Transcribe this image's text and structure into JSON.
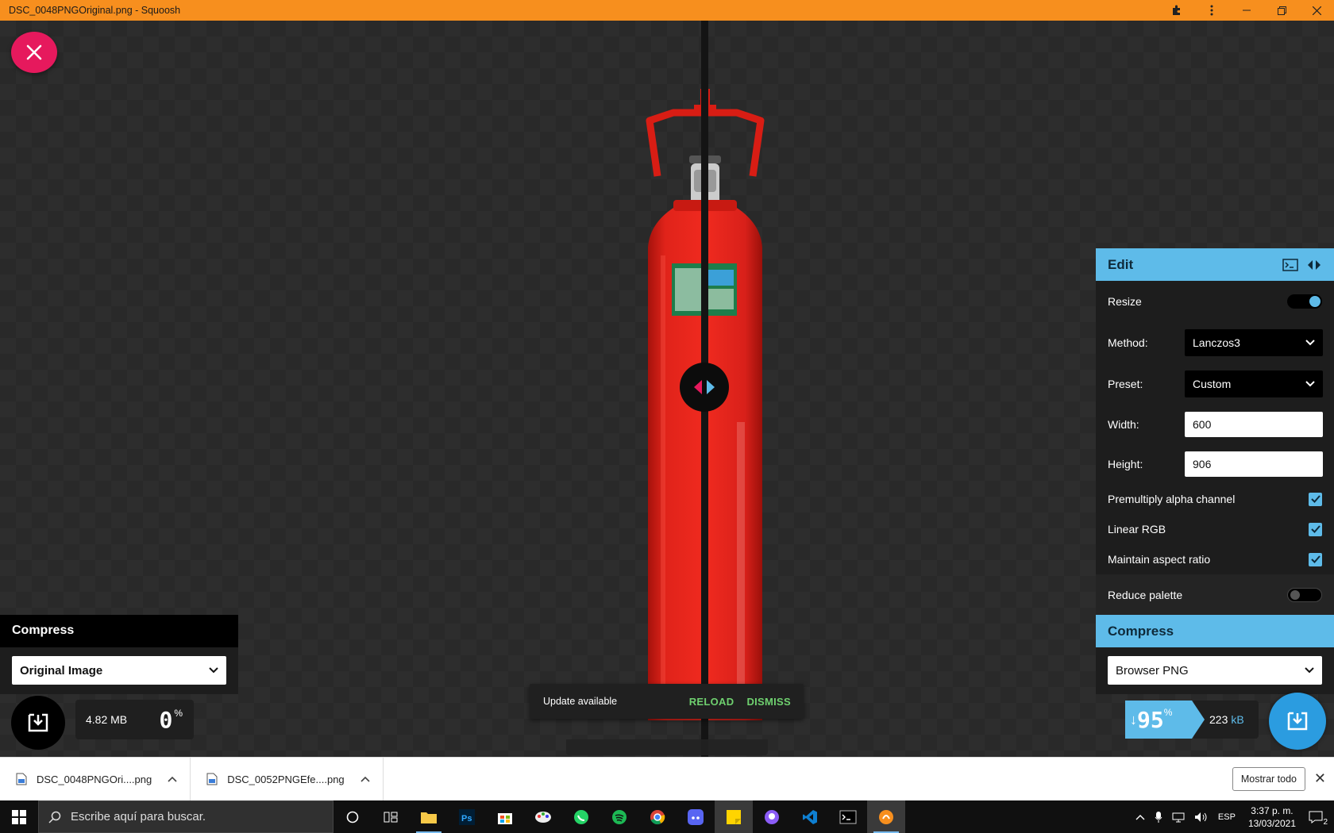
{
  "window": {
    "title": "DSC_0048PNGOriginal.png - Squoosh",
    "icons": [
      "puzzle-icon",
      "kebab-menu-icon",
      "minimize-icon",
      "restore-icon",
      "close-icon"
    ]
  },
  "toast": {
    "message": "Update available",
    "reload_label": "RELOAD",
    "dismiss_label": "DISMISS"
  },
  "left_panel": {
    "header": "Compress",
    "selected_codec": "Original Image",
    "file_size_value": "4.82",
    "file_size_unit": "MB",
    "percent": "0",
    "percent_symbol": "%"
  },
  "right_panel": {
    "header": "Edit",
    "resize_label": "Resize",
    "resize_enabled": true,
    "method_label": "Method:",
    "method_value": "Lanczos3",
    "preset_label": "Preset:",
    "preset_value": "Custom",
    "width_label": "Width:",
    "width_value": "600",
    "height_label": "Height:",
    "height_value": "906",
    "premultiply_label": "Premultiply alpha channel",
    "premultiply_checked": true,
    "linear_rgb_label": "Linear RGB",
    "linear_rgb_checked": true,
    "aspect_label": "Maintain aspect ratio",
    "aspect_checked": true,
    "reduce_palette_label": "Reduce palette",
    "reduce_palette_enabled": false,
    "compress_header": "Compress",
    "codec_value": "Browser PNG",
    "savings_arrow": "↓",
    "savings_value": "95",
    "savings_symbol": "%",
    "output_size_value": "223",
    "output_size_unit": "kB"
  },
  "downloads": {
    "items": [
      {
        "name": "DSC_0048PNGOri....png"
      },
      {
        "name": "DSC_0052PNGEfe....png"
      }
    ],
    "show_all_label": "Mostrar todo"
  },
  "taskbar": {
    "search_placeholder": "Escribe aquí para buscar.",
    "apps": [
      "cortana-icon",
      "task-view-icon",
      "file-explorer-icon",
      "photoshop-icon",
      "store-icon",
      "paint-icon",
      "whatsapp-icon",
      "spotify-icon",
      "chrome-icon",
      "discord-icon",
      "sticky-notes-icon",
      "github-icon",
      "vscode-icon",
      "terminal-icon",
      "squoosh-icon"
    ],
    "language": "ESP",
    "time": "3:37 p. m.",
    "date": "13/03/2021",
    "notification_count": "2"
  },
  "colors": {
    "title_bar": "#f78f1e",
    "accent_blue": "#5ebbe9",
    "close_pink": "#e6195d",
    "toast_action": "#6fd06f"
  }
}
